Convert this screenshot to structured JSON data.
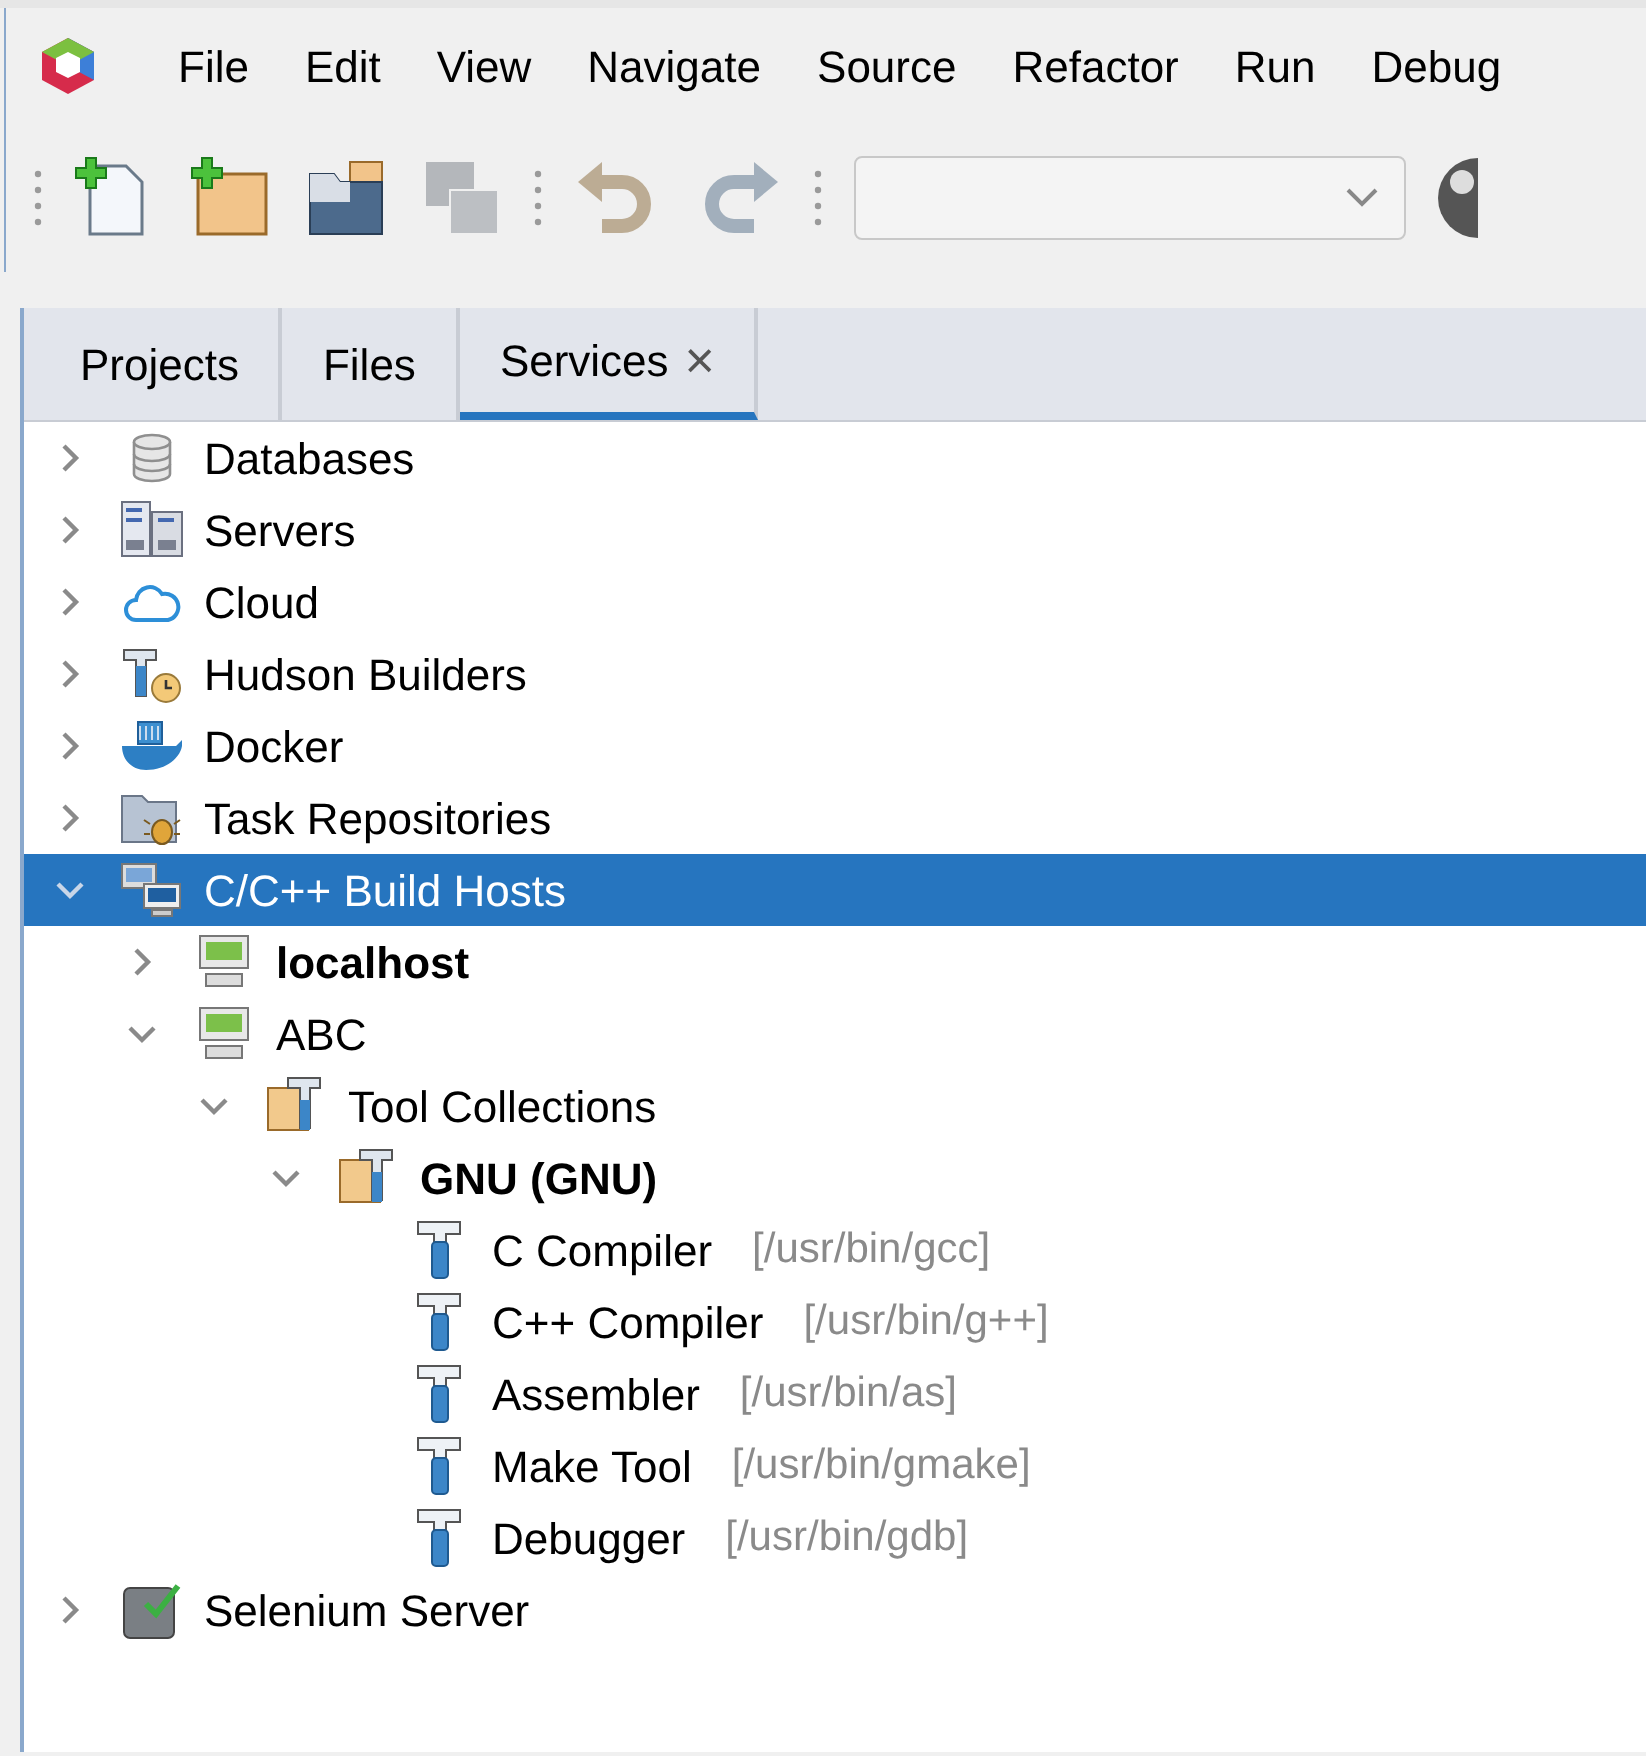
{
  "menu": [
    "File",
    "Edit",
    "View",
    "Navigate",
    "Source",
    "Refactor",
    "Run",
    "Debug"
  ],
  "toolbar": {
    "buttons": [
      {
        "kind": "new-file",
        "disabled": false
      },
      {
        "kind": "new-project",
        "disabled": false
      },
      {
        "kind": "open-project",
        "disabled": false
      },
      {
        "kind": "save-all",
        "disabled": true
      },
      {
        "kind": "undo",
        "disabled": true
      },
      {
        "kind": "redo",
        "disabled": true
      }
    ]
  },
  "tabs": [
    {
      "label": "Projects",
      "selected": false,
      "closable": false
    },
    {
      "label": "Files",
      "selected": false,
      "closable": false
    },
    {
      "label": "Services",
      "selected": true,
      "closable": true,
      "close": "×"
    }
  ],
  "tree": [
    {
      "label": "Databases",
      "kind": "database",
      "expanded": false,
      "selected": false,
      "bold": false
    },
    {
      "label": "Servers",
      "kind": "servers",
      "expanded": false,
      "selected": false,
      "bold": false
    },
    {
      "label": "Cloud",
      "kind": "cloud",
      "expanded": false,
      "selected": false,
      "bold": false
    },
    {
      "label": "Hudson Builders",
      "kind": "hudson",
      "expanded": false,
      "selected": false,
      "bold": false
    },
    {
      "label": "Docker",
      "kind": "docker",
      "expanded": false,
      "selected": false,
      "bold": false
    },
    {
      "label": "Task Repositories",
      "kind": "tasks",
      "expanded": false,
      "selected": false,
      "bold": false
    },
    {
      "label": "C/C++ Build Hosts",
      "kind": "hosts",
      "expanded": true,
      "selected": true,
      "bold": false,
      "children": [
        {
          "label": "localhost",
          "kind": "host",
          "expanded": false,
          "selected": false,
          "bold": true
        },
        {
          "label": "ABC",
          "kind": "host",
          "expanded": true,
          "selected": false,
          "bold": false,
          "children": [
            {
              "label": "Tool Collections",
              "kind": "toolbox",
              "expanded": true,
              "selected": false,
              "bold": false,
              "children": [
                {
                  "label": "GNU (GNU)",
                  "kind": "toolbox",
                  "expanded": true,
                  "selected": false,
                  "bold": true,
                  "children": [
                    {
                      "label": "C Compiler",
                      "detail": "[/usr/bin/gcc]",
                      "kind": "tool",
                      "selected": false,
                      "bold": false
                    },
                    {
                      "label": "C++ Compiler",
                      "detail": "[/usr/bin/g++]",
                      "kind": "tool",
                      "selected": false,
                      "bold": false
                    },
                    {
                      "label": "Assembler",
                      "detail": "[/usr/bin/as]",
                      "kind": "tool",
                      "selected": false,
                      "bold": false
                    },
                    {
                      "label": "Make Tool",
                      "detail": "[/usr/bin/gmake]",
                      "kind": "tool",
                      "selected": false,
                      "bold": false
                    },
                    {
                      "label": "Debugger",
                      "detail": "[/usr/bin/gdb]",
                      "kind": "tool",
                      "selected": false,
                      "bold": false
                    }
                  ]
                }
              ]
            }
          ]
        }
      ]
    },
    {
      "label": "Selenium Server",
      "kind": "selenium",
      "expanded": false,
      "selected": false,
      "bold": false
    }
  ]
}
